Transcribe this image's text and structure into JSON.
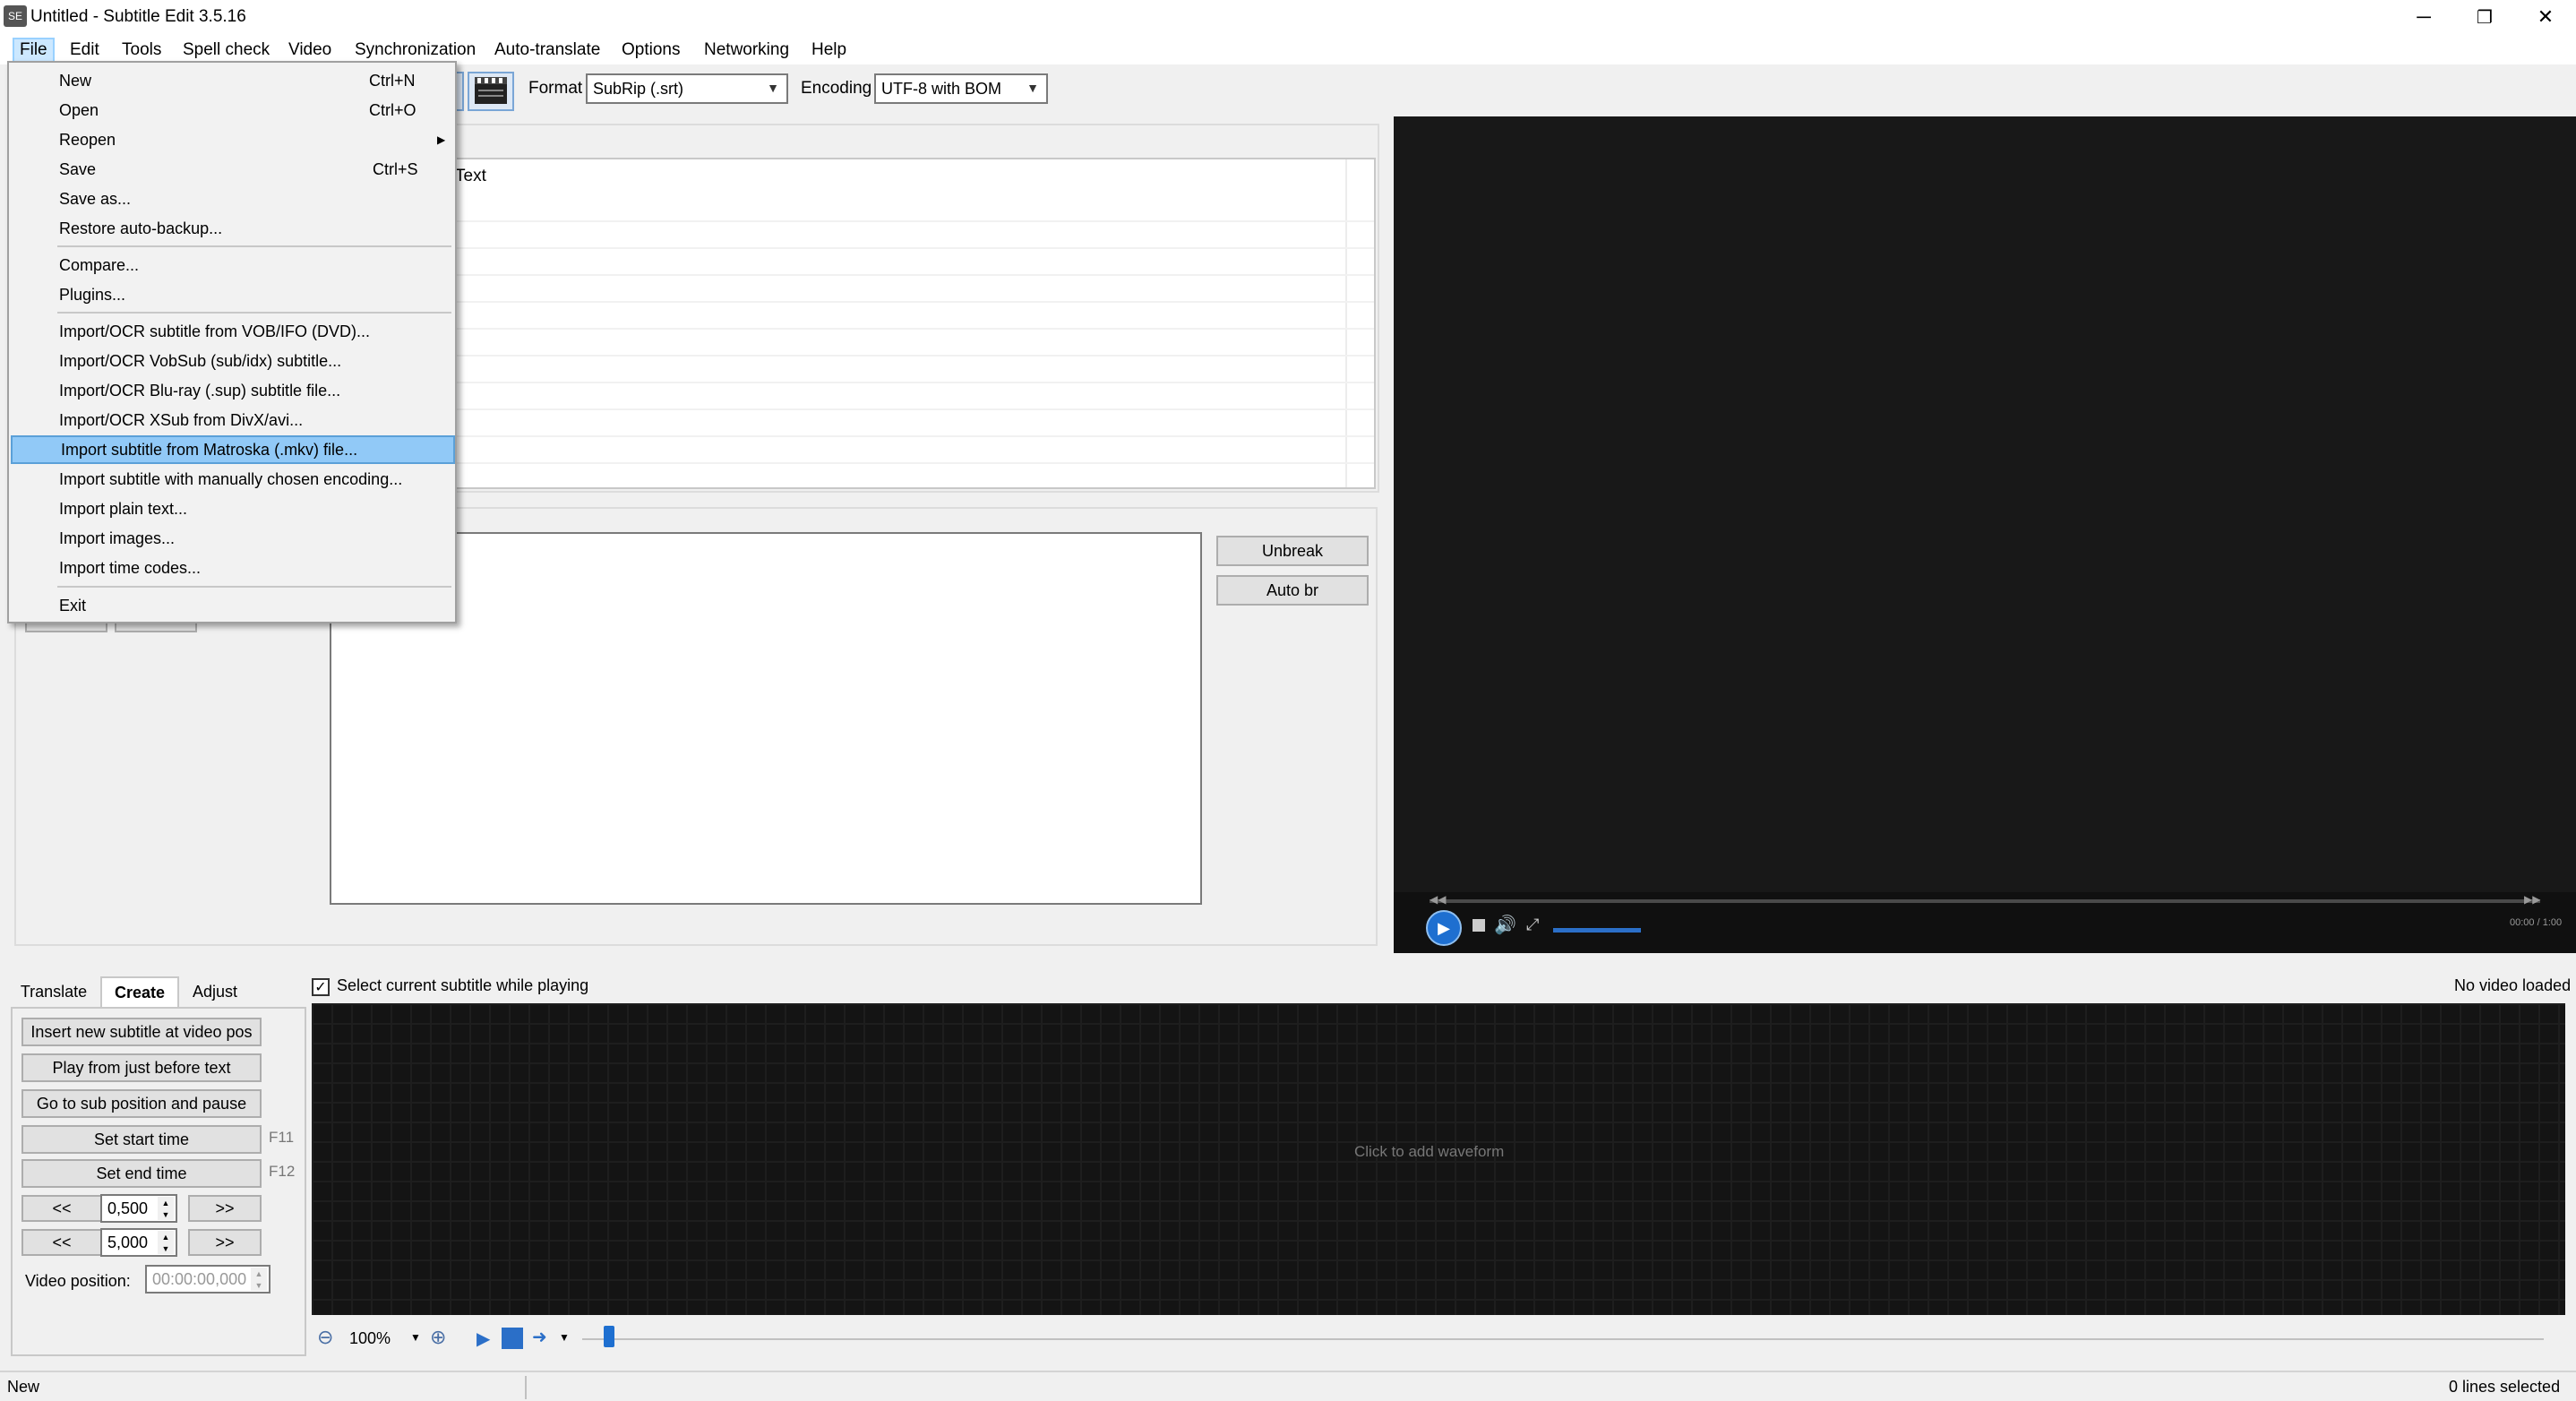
{
  "window": {
    "title": "Untitled - Subtitle Edit 3.5.16",
    "app_icon_text": "SE",
    "controls": {
      "minimize": "─",
      "restore": "❐",
      "close": "✕"
    }
  },
  "menubar": {
    "items": [
      "File",
      "Edit",
      "Tools",
      "Spell check",
      "Video",
      "Synchronization",
      "Auto-translate",
      "Options",
      "Networking",
      "Help"
    ]
  },
  "toolbar": {
    "format_label": "Format",
    "format_value": "SubRip (.srt)",
    "encoding_label": "Encoding",
    "encoding_value": "UTF-8 with BOM"
  },
  "subtitle_list": {
    "text_header": "Text"
  },
  "editor": {
    "unbreak_label": "Unbreak",
    "auto_br_label": "Auto br"
  },
  "file_menu": {
    "new": "New",
    "new_sc": "Ctrl+N",
    "open": "Open",
    "open_sc": "Ctrl+O",
    "reopen": "Reopen",
    "save": "Save",
    "save_sc": "Ctrl+S",
    "save_as": "Save as...",
    "restore": "Restore auto-backup...",
    "compare": "Compare...",
    "plugins": "Plugins...",
    "ocr_vob": "Import/OCR subtitle from VOB/IFO (DVD)...",
    "ocr_vobsub": "Import/OCR VobSub (sub/idx) subtitle...",
    "ocr_bluray": "Import/OCR Blu-ray (.sup) subtitle file...",
    "ocr_xsub": "Import/OCR XSub from DivX/avi...",
    "import_mkv": "Import subtitle from Matroska (.mkv) file...",
    "import_enc": "Import subtitle with manually chosen encoding...",
    "import_plain": "Import plain text...",
    "import_images": "Import images...",
    "import_timecodes": "Import time codes...",
    "exit": "Exit"
  },
  "bottom": {
    "tabs": [
      "Translate",
      "Create",
      "Adjust"
    ],
    "select_current": "Select current subtitle while playing",
    "no_video": "No video loaded",
    "insert_new": "Insert new subtitle at video pos",
    "play_before": "Play from just before text",
    "goto_sub": "Go to sub position and pause",
    "set_start": "Set start time",
    "set_start_key": "F11",
    "set_end": "Set end time",
    "set_end_key": "F12",
    "back": "<<",
    "fwd": ">>",
    "spin1": "0,500",
    "spin2": "5,000",
    "video_pos_label": "Video position:",
    "video_pos_value": "00:00:00,000",
    "waveform_hint": "Click to add waveform",
    "zoom": "100%",
    "video_time": "00:00 / 1:00"
  },
  "status": {
    "left": "New",
    "right": "0 lines selected"
  }
}
